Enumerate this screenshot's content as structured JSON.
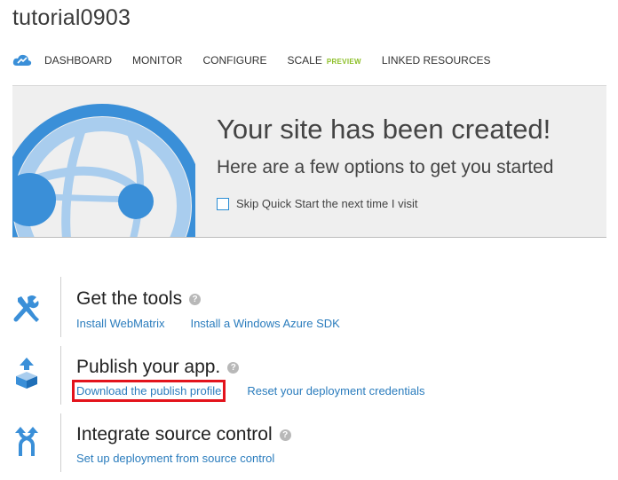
{
  "site": {
    "title": "tutorial0903"
  },
  "nav": {
    "items": [
      {
        "label": "DASHBOARD"
      },
      {
        "label": "MONITOR"
      },
      {
        "label": "CONFIGURE"
      },
      {
        "label": "SCALE",
        "badge": "PREVIEW"
      },
      {
        "label": "LINKED RESOURCES"
      }
    ]
  },
  "banner": {
    "title": "Your site has been created!",
    "subtitle": "Here are a few options to get you started",
    "skip_label": "Skip Quick Start the next time I visit",
    "skip_checked": false
  },
  "sections": [
    {
      "title": "Get the tools",
      "icon": "tools-icon",
      "links": [
        {
          "label": "Install WebMatrix"
        },
        {
          "label": "Install a Windows Azure SDK"
        }
      ]
    },
    {
      "title": "Publish your app.",
      "icon": "publish-icon",
      "links": [
        {
          "label": "Download the publish profile",
          "highlighted": true
        },
        {
          "label": "Reset your deployment credentials"
        }
      ]
    },
    {
      "title": "Integrate source control",
      "icon": "source-control-icon",
      "links": [
        {
          "label": "Set up deployment from source control"
        }
      ]
    }
  ],
  "colors": {
    "accent": "#2a7cbd",
    "icon_blue": "#3a8fd8",
    "preview_green": "#8cbf26",
    "highlight_red": "#e3131c",
    "banner_bg": "#efefef"
  }
}
